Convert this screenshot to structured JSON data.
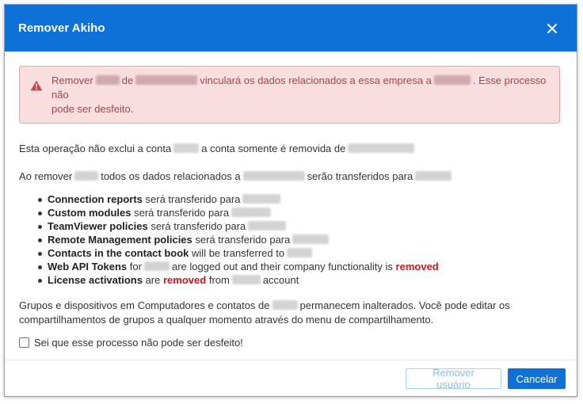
{
  "dialog": {
    "title": "Remover Akiho",
    "close_icon": "close-icon"
  },
  "alert": {
    "icon": "warning-icon",
    "line1_a": "Remover",
    "line1_b": "de",
    "line1_c": "vinculará os dados relacionados a essa empresa a",
    "line1_d": ". Esse processo não",
    "line2": "pode ser desfeito."
  },
  "para1": {
    "a": "Esta operação não exclui a conta",
    "b": "a conta somente é removida de"
  },
  "para2": {
    "a": "Ao remover",
    "b": "todos os dados relacionados a",
    "c": "serão transferidos para"
  },
  "items": [
    {
      "bold": "Connection reports",
      "text": "será transferido para"
    },
    {
      "bold": "Custom modules",
      "text": "será transferido para"
    },
    {
      "bold": "TeamViewer policies",
      "text": "será transferido para"
    },
    {
      "bold": "Remote Management policies",
      "text": "será transferido para"
    },
    {
      "bold": "Contacts in the contact book",
      "text": "will be transferred to"
    },
    {
      "bold": "Web API Tokens",
      "text_a": "for",
      "text_b": "are logged out and their company functionality is",
      "emph": "removed"
    },
    {
      "bold": "License activations",
      "text_a": "are",
      "emph": "removed",
      "text_b": "from",
      "text_c": "account"
    }
  ],
  "para3": {
    "a": "Grupos e dispositivos em Computadores e contatos de",
    "b": "permanecem inalterados. Você pode editar os",
    "c": "compartilhamentos de grupos a qualquer momento através do menu de compartilhamento."
  },
  "confirm_checkbox": {
    "label": "Sei que esse processo não pode ser desfeito!",
    "checked": false
  },
  "buttons": {
    "remove_label": "Remover usuário",
    "cancel_label": "Cancelar"
  },
  "colors": {
    "header": "#0e71d8",
    "alert_bg": "#f8dedf",
    "alert_text": "#a2474c",
    "removed": "#d6141d"
  }
}
